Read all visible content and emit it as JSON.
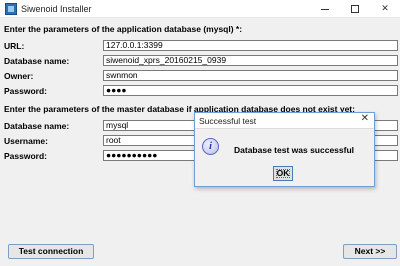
{
  "window": {
    "title": "Siwenoid Installer",
    "controls": {
      "minimize": "minimize",
      "maximize": "maximize",
      "close": "✕"
    }
  },
  "app_db": {
    "heading": "Enter the parameters of the application database (mysql) *:",
    "url_label": "URL:",
    "url_value": "127.0.0.1:3399",
    "dbname_label": "Database name:",
    "dbname_value": "siwenoid_xprs_20160215_0939",
    "owner_label": "Owner:",
    "owner_value": "swnmon",
    "password_label": "Password:",
    "password_value": "●●●●"
  },
  "master_db": {
    "heading": "Enter the parameters of the master database if application database does not exist yet:",
    "dbname_label": "Database name:",
    "dbname_value": "mysql",
    "username_label": "Username:",
    "username_value": "root",
    "password_label": "Password:",
    "password_value": "●●●●●●●●●●"
  },
  "buttons": {
    "test_connection": "Test connection",
    "next": "Next >>"
  },
  "dialog": {
    "title": "Successful test",
    "close": "✕",
    "icon": "info-icon",
    "icon_glyph": "i",
    "message": "Database test was successful",
    "ok": "OK"
  }
}
